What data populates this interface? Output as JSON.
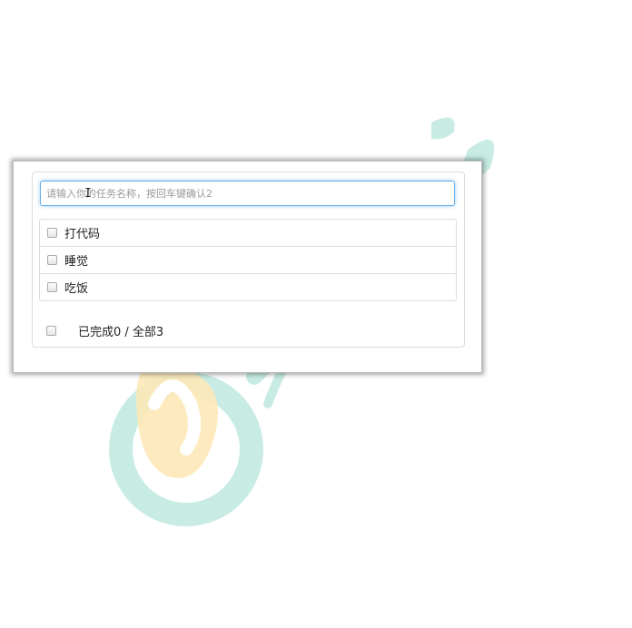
{
  "input": {
    "placeholder": "请输入你的任务名称，按回车键确认2",
    "value": ""
  },
  "tasks": [
    {
      "label": "打代码",
      "done": false
    },
    {
      "label": "睡觉",
      "done": false
    },
    {
      "label": "吃饭",
      "done": false
    }
  ],
  "footer": {
    "summary": "已完成0 / 全部3",
    "select_all_checked": false
  },
  "colors": {
    "focus_border": "#66afe9",
    "watermark_teal": "#bfe9e0",
    "watermark_yellow": "#fde9b8"
  }
}
